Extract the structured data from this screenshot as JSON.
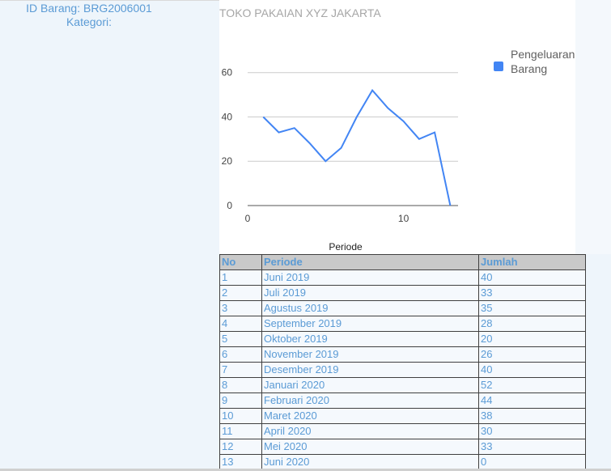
{
  "sidebar": {
    "id_label": "ID Barang: BRG2006001",
    "category_label": "Kategori:"
  },
  "chart_title": "TOKO PAKAIAN XYZ JAKARTA",
  "chart_data": {
    "type": "line",
    "title": "TOKO PAKAIAN XYZ JAKARTA",
    "xlabel": "Periode",
    "ylabel": "",
    "x": [
      1,
      2,
      3,
      4,
      5,
      6,
      7,
      8,
      9,
      10,
      11,
      12,
      13
    ],
    "series": [
      {
        "name": "Pengeluaran Barang",
        "values": [
          40,
          33,
          35,
          28,
          20,
          26,
          40,
          52,
          44,
          38,
          30,
          33,
          0
        ]
      }
    ],
    "xlim": [
      0,
      13.5
    ],
    "ylim": [
      0,
      65
    ],
    "xticks": [
      "0",
      "10"
    ],
    "yticks": [
      "0",
      "20",
      "40",
      "60"
    ],
    "legend_position": "right",
    "grid": true,
    "line_color": "#4285f4"
  },
  "legend": {
    "line1": "Pengeluaran",
    "line2": "Barang"
  },
  "table": {
    "headers": [
      "No",
      "Periode",
      "Jumlah"
    ],
    "rows": [
      [
        "1",
        "Juni 2019",
        "40"
      ],
      [
        "2",
        "Juli 2019",
        "33"
      ],
      [
        "3",
        "Agustus 2019",
        "35"
      ],
      [
        "4",
        "September 2019",
        "28"
      ],
      [
        "5",
        "Oktober 2019",
        "20"
      ],
      [
        "6",
        "November 2019",
        "26"
      ],
      [
        "7",
        "Desember 2019",
        "40"
      ],
      [
        "8",
        "Januari 2020",
        "52"
      ],
      [
        "9",
        "Februari 2020",
        "44"
      ],
      [
        "10",
        "Maret 2020",
        "38"
      ],
      [
        "11",
        "April 2020",
        "30"
      ],
      [
        "12",
        "Mei 2020",
        "33"
      ],
      [
        "13",
        "Juni 2020",
        "0"
      ]
    ]
  }
}
